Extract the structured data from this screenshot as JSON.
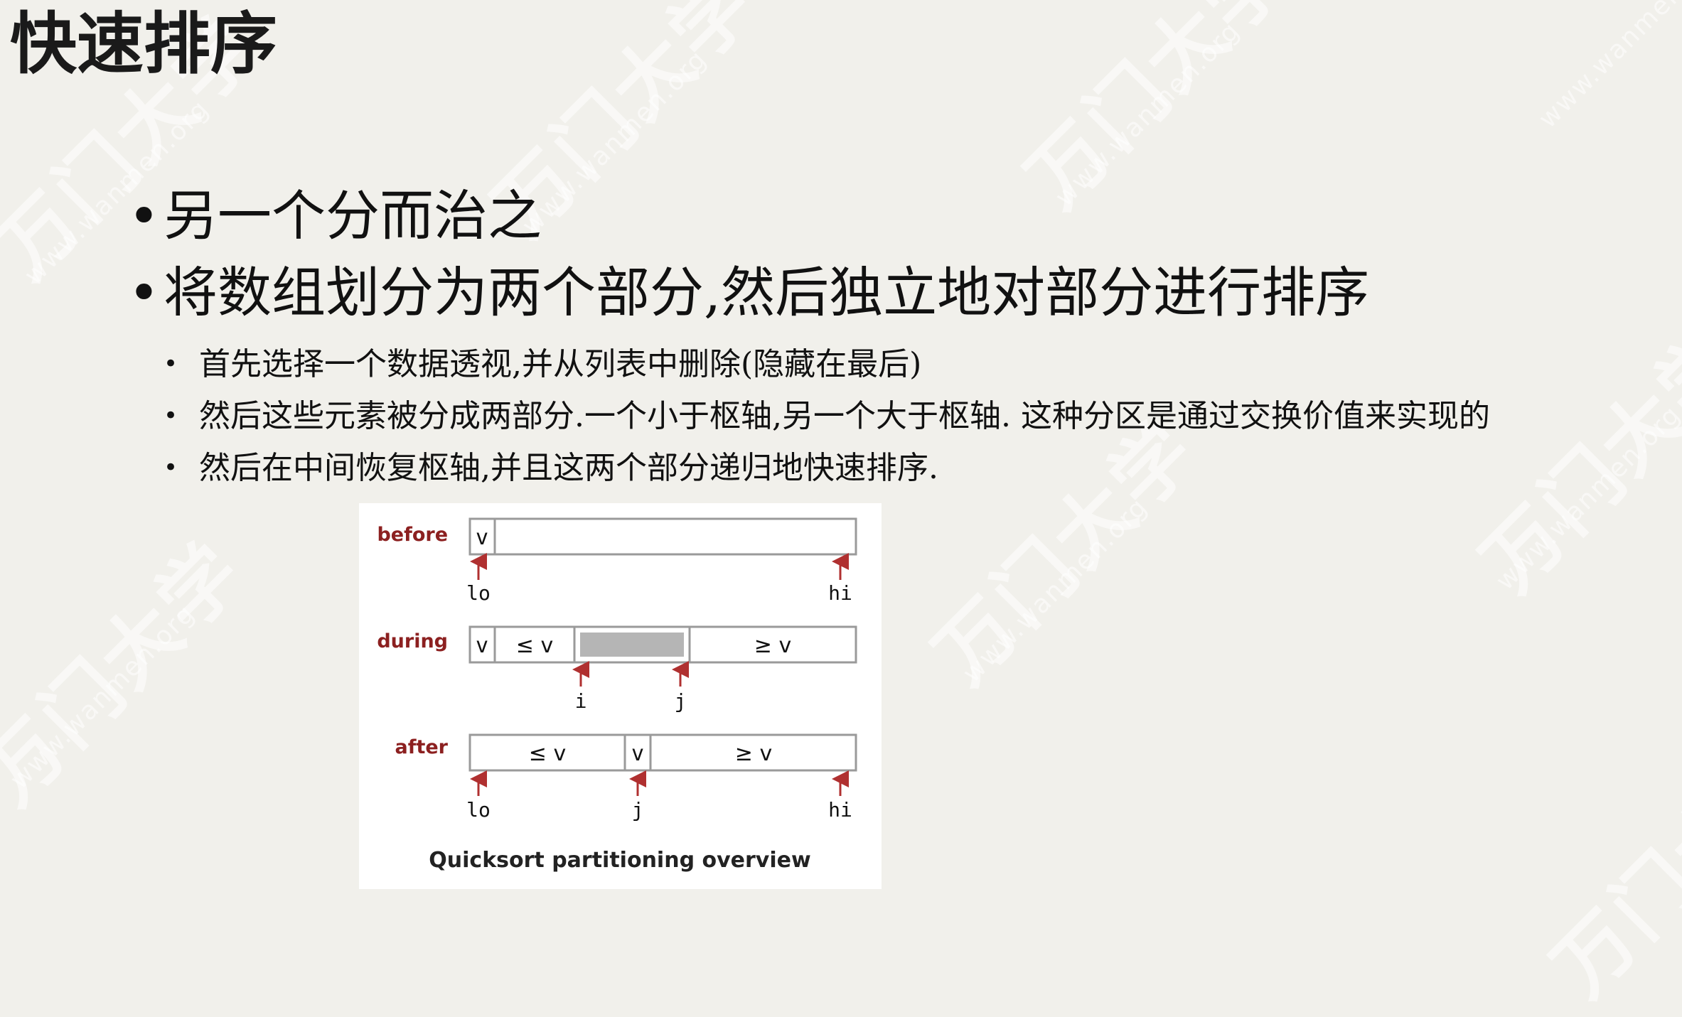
{
  "slide": {
    "title": "快速排序"
  },
  "bullets": [
    {
      "text": "另一个分而治之",
      "children": []
    },
    {
      "text": "将数组划分为两个部分,然后独立地对部分进行排序",
      "children": [
        "首先选择一个数据透视,并从列表中删除(隐藏在最后)",
        "然后这些元素被分成两部分.一个小于枢轴,另一个大于枢轴. 这种分区是通过交换价值来实现的",
        "然后在中间恢复枢轴,并且这两个部分递归地快速排序."
      ]
    }
  ],
  "figure": {
    "caption": "Quicksort partitioning overview",
    "rows": {
      "before": {
        "label": "before",
        "cells": [
          "v",
          ""
        ],
        "markers": [
          "lo",
          "hi"
        ]
      },
      "during": {
        "label": "during",
        "cells": [
          "v",
          "≤ v",
          "",
          "≥ v"
        ],
        "markers": [
          "i",
          "j"
        ]
      },
      "after": {
        "label": "after",
        "cells": [
          "≤ v",
          "v",
          "≥ v"
        ],
        "markers": [
          "lo",
          "j",
          "hi"
        ]
      }
    },
    "colors": {
      "row_label": "#8c2020",
      "arrow": "#b03030",
      "unknown_fill": "#b5b5b5",
      "border": "#9a9a9a"
    }
  },
  "watermark": {
    "brand": "万门大学",
    "url": "www.wanmen.org"
  }
}
